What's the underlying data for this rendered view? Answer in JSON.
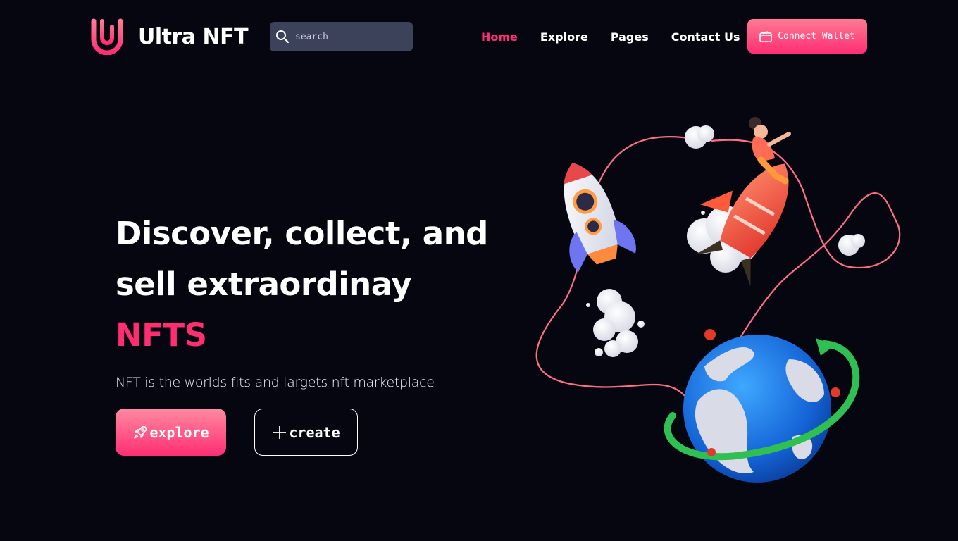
{
  "brand": {
    "name": "Ultra NFT",
    "accent_color": "#ff2e73",
    "gradient_start": "#ff7a93",
    "background": "#05060f"
  },
  "search": {
    "placeholder": "search",
    "value": ""
  },
  "nav": {
    "items": [
      {
        "label": "Home",
        "active": true
      },
      {
        "label": "Explore",
        "active": false
      },
      {
        "label": "Pages",
        "active": false
      },
      {
        "label": "Contact Us",
        "active": false
      }
    ],
    "connect_wallet_label": "Connect Wallet"
  },
  "hero": {
    "title_line1": "Discover, collect, and",
    "title_line2": "sell extraordinay",
    "title_accent": "NFTS",
    "subtitle": "NFT is the worlds fits and largets nft marketplace",
    "explore_label": "explore",
    "create_label": "create"
  },
  "icons": {
    "search": "search-icon",
    "wallet": "wallet-icon",
    "rocket": "rocket-icon",
    "plus": "plus-icon"
  }
}
